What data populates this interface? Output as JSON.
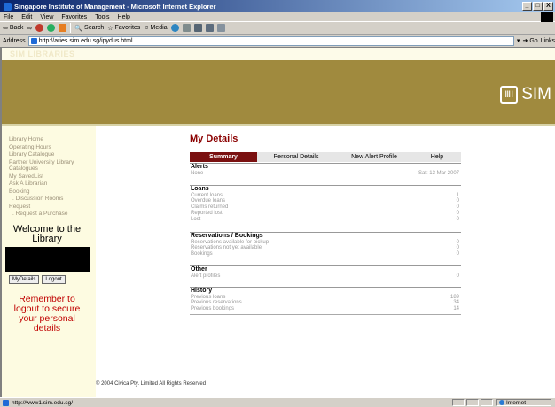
{
  "window": {
    "title": "Singapore Institute of Management - Microsoft Internet Explorer",
    "controls": [
      "_",
      "□",
      "X"
    ]
  },
  "menu": [
    "File",
    "Edit",
    "View",
    "Favorites",
    "Tools",
    "Help"
  ],
  "toolbar": {
    "back": "Back",
    "search": "Search",
    "favorites": "Favorites",
    "media": "Media"
  },
  "address": {
    "label": "Address",
    "url": "http://aries.sim.edu.sg/ipydus.html",
    "go": "Go",
    "links": "Links"
  },
  "site": {
    "header_text": "SIM LIBRARIES",
    "logo_text": "SIM"
  },
  "sidebar": {
    "links": [
      {
        "label": "Library Home"
      },
      {
        "label": "Operating Hours"
      },
      {
        "label": "Library Catalogue"
      },
      {
        "label": "Partner University Library Catalogues"
      },
      {
        "label": "My SavedList"
      },
      {
        "label": "Ask A Librarian"
      },
      {
        "label": "Booking"
      },
      {
        "label": ". Discussion Rooms"
      },
      {
        "label": "Request"
      },
      {
        "label": ". Request a Purchase"
      }
    ],
    "welcome": "Welcome to the Library",
    "btn_mydetails": "MyDetails",
    "btn_logout": "Logout",
    "remember": "Remember to logout to secure your personal details"
  },
  "main": {
    "title": "My Details",
    "tabs": [
      "Summary",
      "Personal Details",
      "New Alert Profile",
      "Help"
    ],
    "sections": [
      {
        "heading": "Alerts",
        "rows": [
          {
            "label": "None",
            "value": "Sat: 13 Mar 2007"
          }
        ]
      },
      {
        "heading": "Loans",
        "rows": [
          {
            "label": "Current loans",
            "value": "1"
          },
          {
            "label": "Overdue loans",
            "value": "0"
          },
          {
            "label": "Claims returned",
            "value": "0"
          },
          {
            "label": "Reported lost",
            "value": "0"
          },
          {
            "label": "Lost",
            "value": "0"
          }
        ]
      },
      {
        "heading": "Reservations / Bookings",
        "rows": [
          {
            "label": "Reservations available for pickup",
            "value": "0"
          },
          {
            "label": "Reservations not yet available",
            "value": "0"
          },
          {
            "label": "Bookings",
            "value": "0"
          }
        ]
      },
      {
        "heading": "Other",
        "rows": [
          {
            "label": "Alert profiles",
            "value": "0"
          }
        ]
      },
      {
        "heading": "History",
        "rows": [
          {
            "label": "Previous loans",
            "value": "189"
          },
          {
            "label": "Previous reservations",
            "value": "34"
          },
          {
            "label": "Previous bookings",
            "value": "14"
          }
        ]
      }
    ],
    "copyright": "© 2004 Civica Pty. Limited All Rights Reserved"
  },
  "status": {
    "url": "http://www1.sim.edu.sg/",
    "zone": "Internet"
  }
}
